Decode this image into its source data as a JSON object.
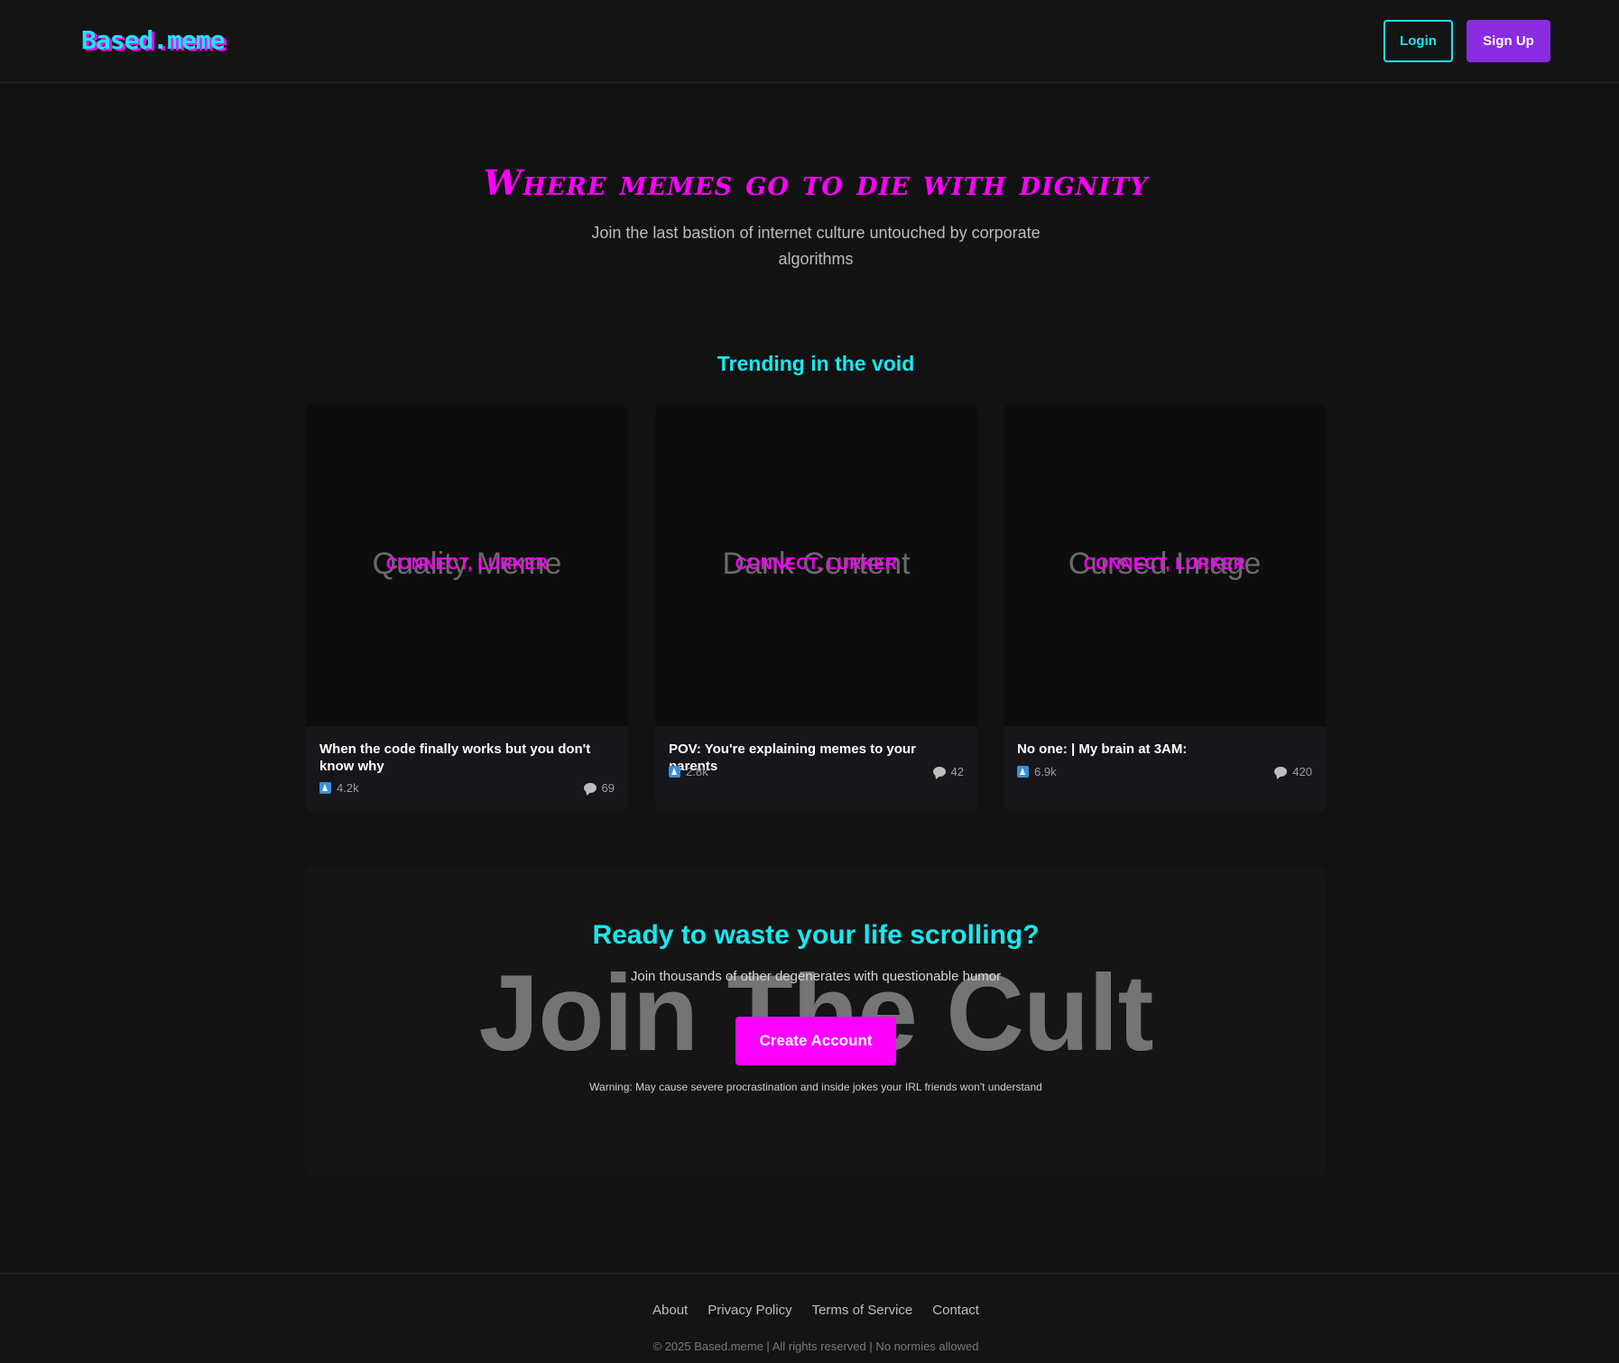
{
  "header": {
    "logo": "Based.meme",
    "login_label": "Login",
    "signup_label": "Sign Up"
  },
  "hero": {
    "title": "Where memes go to die with dignity",
    "subtitle": "Join the last bastion of internet culture untouched by corporate algorithms"
  },
  "trending": {
    "title": "Trending in the void",
    "cards": [
      {
        "placeholder": "Quality Meme",
        "overlay": "CONNECT, LURKER",
        "title": "When the code finally works but you don't know why",
        "upvotes": "4.2k",
        "comments": "69"
      },
      {
        "placeholder": "Dank Content",
        "overlay": "CONNECT, LURKER",
        "title": "POV: You're explaining memes to your parents",
        "upvotes": "2.8k",
        "comments": "42"
      },
      {
        "placeholder": "Cursed Image",
        "overlay": "CONNECT, LURKER",
        "title": "No one: | My brain at 3AM:",
        "upvotes": "6.9k",
        "comments": "420"
      }
    ]
  },
  "cta": {
    "bg_text": "Join The Cult",
    "title": "Ready to waste your life scrolling?",
    "subtitle": "Join thousands of other degenerates with questionable humor",
    "button_label": "Create Account",
    "warning": "Warning: May cause severe procrastination and inside jokes your IRL friends won't understand"
  },
  "footer": {
    "links": [
      "About",
      "Privacy Policy",
      "Terms of Service",
      "Contact"
    ],
    "copyright": "© 2025 Based.meme | All rights reserved | No normies allowed"
  },
  "colors": {
    "accent_cyan": "#17e8f0",
    "accent_magenta": "#ff00ff",
    "accent_purple": "#8a2be2",
    "background": "#121212"
  },
  "icons": [
    "upvote-icon",
    "comment-icon"
  ]
}
